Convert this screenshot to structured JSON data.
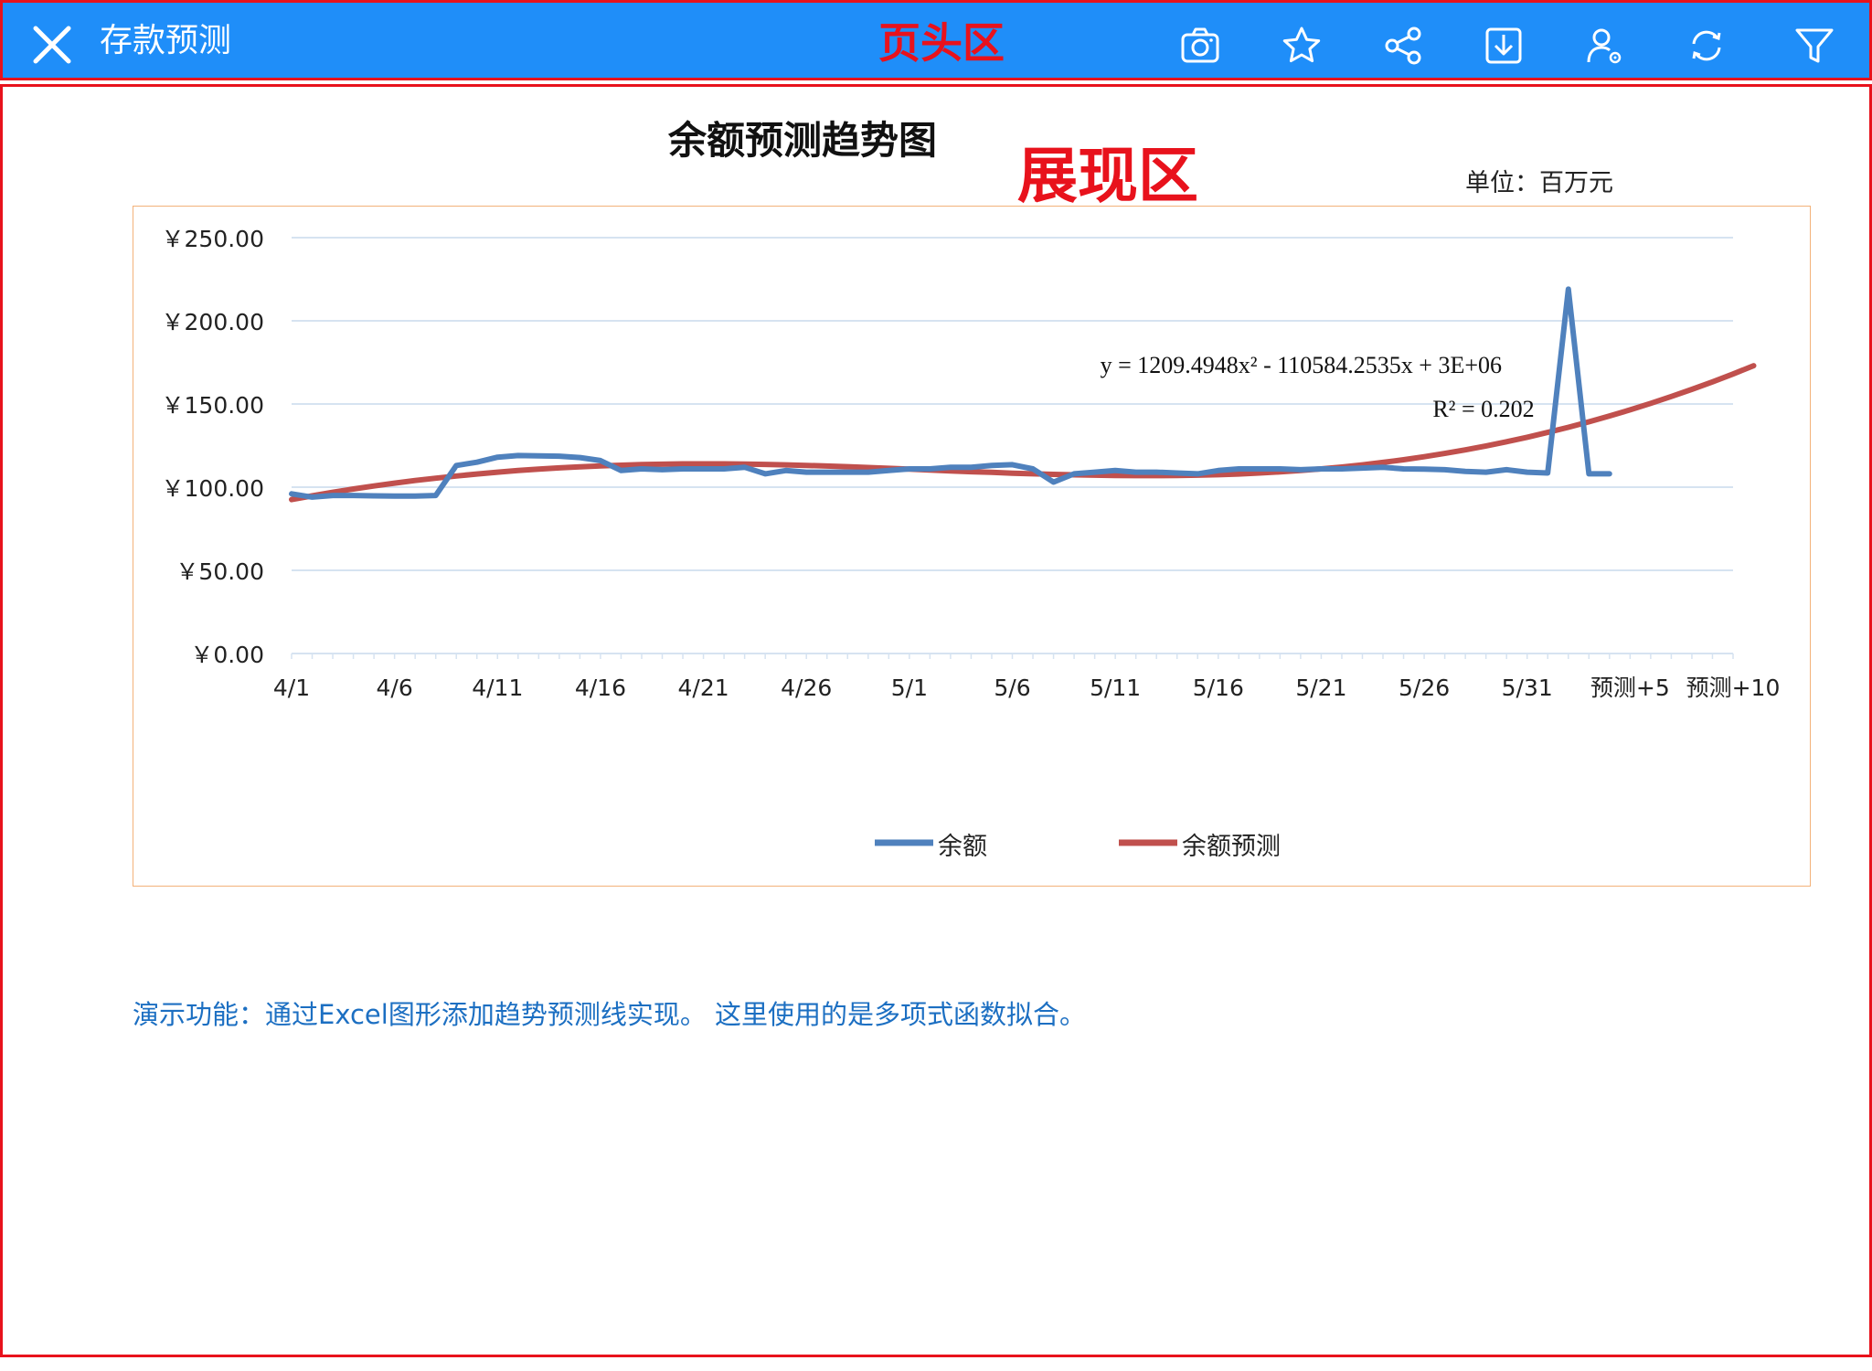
{
  "header": {
    "title": "存款预测",
    "annotation": "页头区",
    "toolbar": [
      {
        "icon": "camera-icon",
        "name": "screenshot-button"
      },
      {
        "icon": "star-icon",
        "name": "favorite-button"
      },
      {
        "icon": "share-icon",
        "name": "share-button"
      },
      {
        "icon": "download-icon",
        "name": "download-button"
      },
      {
        "icon": "user-settings-icon",
        "name": "user-settings-button"
      },
      {
        "icon": "refresh-icon",
        "name": "refresh-button"
      },
      {
        "icon": "filter-icon",
        "name": "filter-button"
      }
    ]
  },
  "content": {
    "annotation": "展现区",
    "unit_label": "单位：百万元",
    "footnote": "演示功能：通过Excel图形添加趋势预测线实现。 这里使用的是多项式函数拟合。"
  },
  "colors": {
    "header_bg": "#1f8ef9",
    "annotation_red": "#e8121c",
    "series_balance": "#4f81bd",
    "series_forecast": "#c0504d",
    "footnote_blue": "#1c6fc2"
  },
  "chart_data": {
    "type": "line",
    "title": "余额预测趋势图",
    "ylim": [
      0,
      250
    ],
    "yticks": [
      "￥0.00",
      "￥50.00",
      "￥100.00",
      "￥150.00",
      "￥200.00",
      "￥250.00"
    ],
    "ytick_values": [
      0,
      50,
      100,
      150,
      200,
      250
    ],
    "x_tick_labels": [
      "4/1",
      "4/6",
      "4/11",
      "4/16",
      "4/21",
      "4/26",
      "5/1",
      "5/6",
      "5/11",
      "5/16",
      "5/21",
      "5/26",
      "5/31",
      "预测+5",
      "预测+10"
    ],
    "x_count": 71,
    "grid": true,
    "legend_position": "bottom",
    "trendline_equation": "y = 1209.4948x² - 110584.2535x + 3E+06",
    "trendline_r2": "R² = 0.202",
    "series": [
      {
        "name": "余额",
        "values": [
          96,
          94,
          95,
          95,
          94.8,
          94.6,
          94.6,
          95,
          113,
          115,
          118,
          119,
          118.8,
          118.6,
          117.8,
          116,
          110,
          111,
          110.5,
          111,
          111,
          111,
          112,
          108,
          110,
          109,
          109,
          109,
          109,
          110,
          111,
          111,
          112,
          112,
          113,
          113.5,
          111,
          103,
          108,
          109,
          110,
          109,
          109,
          108.5,
          108,
          110,
          111,
          111,
          111,
          110.5,
          111,
          111,
          111.5,
          112,
          111,
          110.8,
          110.5,
          109.5,
          109,
          110.5,
          109,
          108.5,
          219,
          108,
          108
        ]
      },
      {
        "name": "余额预测",
        "values": [
          92.5,
          94.8,
          96.9,
          98.9,
          100.7,
          102.4,
          104,
          105.4,
          106.7,
          107.9,
          109,
          110,
          110.8,
          111.6,
          112.2,
          112.8,
          113.2,
          113.6,
          113.8,
          114,
          114,
          114,
          113.9,
          113.7,
          113.4,
          113.1,
          112.7,
          112.3,
          111.8,
          111.3,
          110.8,
          110.3,
          109.8,
          109.3,
          108.9,
          108.4,
          108,
          107.7,
          107.4,
          107.2,
          107,
          106.9,
          106.9,
          107,
          107.2,
          107.5,
          107.9,
          108.5,
          109.2,
          110,
          111,
          112.1,
          113.4,
          114.9,
          116.5,
          118.3,
          120.3,
          122.4,
          124.8,
          127.3,
          130,
          132.9,
          136,
          139.3,
          142.8,
          146.5,
          150.4,
          154.5,
          158.8,
          163.3,
          168,
          173
        ]
      }
    ]
  }
}
